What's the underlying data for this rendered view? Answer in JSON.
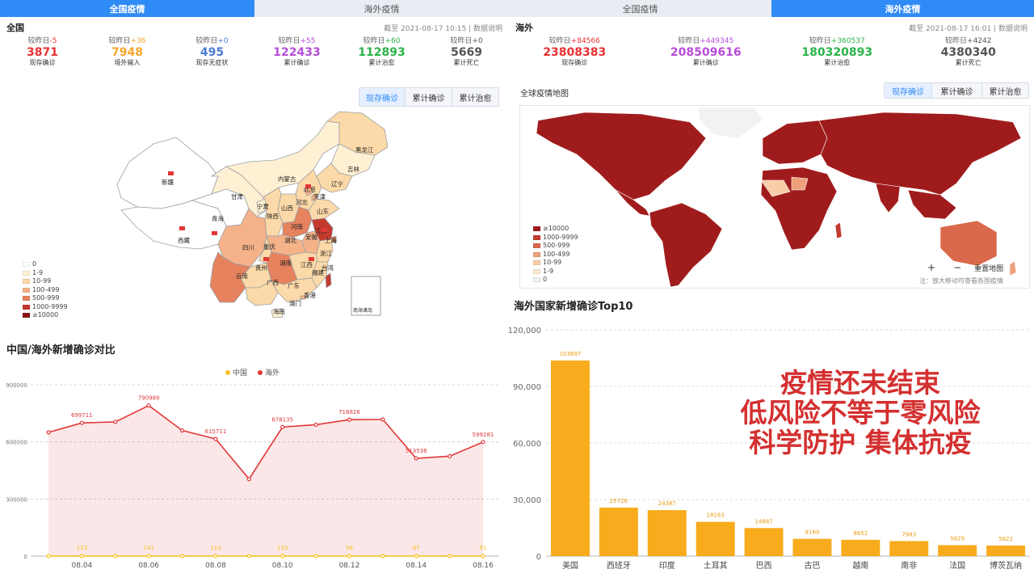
{
  "left": {
    "tabs": [
      {
        "label": "全国疫情"
      },
      {
        "label": "海外疫情"
      }
    ],
    "section_title": "全国",
    "timestamp": "截至 2021-08-17 10:15",
    "separator": "|",
    "notes_link": "数据说明",
    "stats": [
      {
        "cmp_label": "较昨日",
        "delta": "-5",
        "value": "3871",
        "label": "现存确诊",
        "color": "#e83132"
      },
      {
        "cmp_label": "较昨日",
        "delta": "+36",
        "value": "7948",
        "label": "境外输入",
        "color": "#f8a42c"
      },
      {
        "cmp_label": "较昨日",
        "delta": "+0",
        "value": "495",
        "label": "现存无症状",
        "color": "#4a7bd2"
      },
      {
        "cmp_label": "较昨日",
        "delta": "+55",
        "value": "122433",
        "label": "累计确诊",
        "color": "#b84cd8"
      },
      {
        "cmp_label": "较昨日",
        "delta": "+60",
        "value": "112893",
        "label": "累计治愈",
        "color": "#2bb34a"
      },
      {
        "cmp_label": "较昨日",
        "delta": "+0",
        "value": "5669",
        "label": "累计死亡",
        "color": "#555555"
      }
    ],
    "map_buttons": [
      "现存确诊",
      "累计确诊",
      "累计治愈"
    ],
    "map_legend": [
      {
        "label": "0",
        "color": "#ffffff"
      },
      {
        "label": "1-9",
        "color": "#fff0d3"
      },
      {
        "label": "10-99",
        "color": "#fcd9a8"
      },
      {
        "label": "100-499",
        "color": "#f5b288"
      },
      {
        "label": "500-999",
        "color": "#e6825d"
      },
      {
        "label": "1000-9999",
        "color": "#c33a2e"
      },
      {
        "label": "≥10000",
        "color": "#8a1414"
      }
    ],
    "provinces": [
      "黑龙江",
      "吉林",
      "辽宁",
      "内蒙古",
      "北京",
      "天津",
      "河北",
      "山西",
      "山东",
      "河南",
      "陕西",
      "宁夏",
      "甘肃",
      "青海",
      "新疆",
      "西藏",
      "四川",
      "重庆",
      "湖北",
      "安徽",
      "江苏",
      "上海",
      "浙江",
      "江西",
      "福建",
      "湖南",
      "贵州",
      "云南",
      "广西",
      "广东",
      "香港",
      "澳门",
      "台湾",
      "海南",
      "南海诸岛"
    ],
    "chart_title": "中国/海外新增确诊对比"
  },
  "right": {
    "tabs": [
      {
        "label": "全国疫情"
      },
      {
        "label": "海外疫情"
      }
    ],
    "section_title": "海外",
    "timestamp": "截至 2021-08-17 16:01",
    "separator": "|",
    "notes_link": "数据说明",
    "stats": [
      {
        "cmp_label": "较昨日",
        "delta": "+84566",
        "value": "23808383",
        "label": "现存确诊",
        "color": "#e83132"
      },
      {
        "cmp_label": "较昨日",
        "delta": "+449345",
        "value": "208509616",
        "label": "累计确诊",
        "color": "#b84cd8"
      },
      {
        "cmp_label": "较昨日",
        "delta": "+360537",
        "value": "180320893",
        "label": "累计治愈",
        "color": "#2bb34a"
      },
      {
        "cmp_label": "较昨日",
        "delta": "+4242",
        "value": "4380340",
        "label": "累计死亡",
        "color": "#555555"
      }
    ],
    "map_title": "全球疫情地图",
    "map_buttons": [
      "现存确诊",
      "累计确诊",
      "累计治愈"
    ],
    "map_legend": [
      {
        "label": "≥10000",
        "color": "#a01c1c"
      },
      {
        "label": "1000-9999",
        "color": "#c33a2e"
      },
      {
        "label": "500-999",
        "color": "#d9694a"
      },
      {
        "label": "100-499",
        "color": "#eda07a"
      },
      {
        "label": "10-99",
        "color": "#f8cda8"
      },
      {
        "label": "1-9",
        "color": "#fdebd1"
      },
      {
        "label": "0",
        "color": "#f2f2f2"
      }
    ],
    "zoom_in": "+",
    "zoom_out": "−",
    "reset_map": "重置地图",
    "map_note": "注：放大移动可查看各国疫情",
    "chart_title": "海外国家新增确诊Top10"
  },
  "slogan": [
    "疫情还未结束",
    "低风险不等于零风险",
    "科学防护 集体抗疫"
  ],
  "chart_data": [
    {
      "type": "line",
      "title": "中国/海外新增确诊对比",
      "legend": [
        "中国",
        "海外"
      ],
      "legend_position": "top-center",
      "x": [
        "08.03",
        "08.04",
        "08.05",
        "08.06",
        "08.07",
        "08.08",
        "08.09",
        "08.10",
        "08.11",
        "08.12",
        "08.13",
        "08.14",
        "08.15",
        "08.16"
      ],
      "x_tick_labels": [
        "08.04",
        "08.06",
        "08.08",
        "08.10",
        "08.12",
        "08.14",
        "08.16"
      ],
      "ylim": [
        0,
        900000
      ],
      "y_ticks": [
        "0",
        "300000",
        "600000",
        "900000"
      ],
      "grid": true,
      "series": [
        {
          "name": "中国",
          "color": "#f6c324",
          "values": [
            122,
            123,
            130,
            141,
            125,
            113,
            118,
            133,
            120,
            98,
            90,
            87,
            70,
            61
          ],
          "labeled_index": [
            1,
            3,
            5,
            7,
            9,
            11,
            13
          ]
        },
        {
          "name": "海外",
          "color": "#e23838",
          "area": true,
          "values": [
            650000,
            699711,
            705000,
            790989,
            660000,
            615711,
            405000,
            678135,
            690000,
            716826,
            718000,
            513536,
            525000,
            599281
          ],
          "labeled_index": [
            1,
            3,
            5,
            7,
            9,
            11,
            13
          ]
        }
      ]
    },
    {
      "type": "bar",
      "title": "海外国家新增确诊Top10",
      "categories": [
        "美国",
        "西班牙",
        "印度",
        "土耳其",
        "巴西",
        "古巴",
        "越南",
        "南非",
        "法国",
        "博茨瓦纳"
      ],
      "values": [
        103697,
        25726,
        24387,
        18163,
        14887,
        9169,
        8652,
        7983,
        5829,
        5622
      ],
      "ylim": [
        0,
        120000
      ],
      "y_ticks": [
        "0",
        "30,000",
        "60,000",
        "90,000",
        "120,000"
      ],
      "color": "#f8ab1c",
      "grid": true
    }
  ]
}
